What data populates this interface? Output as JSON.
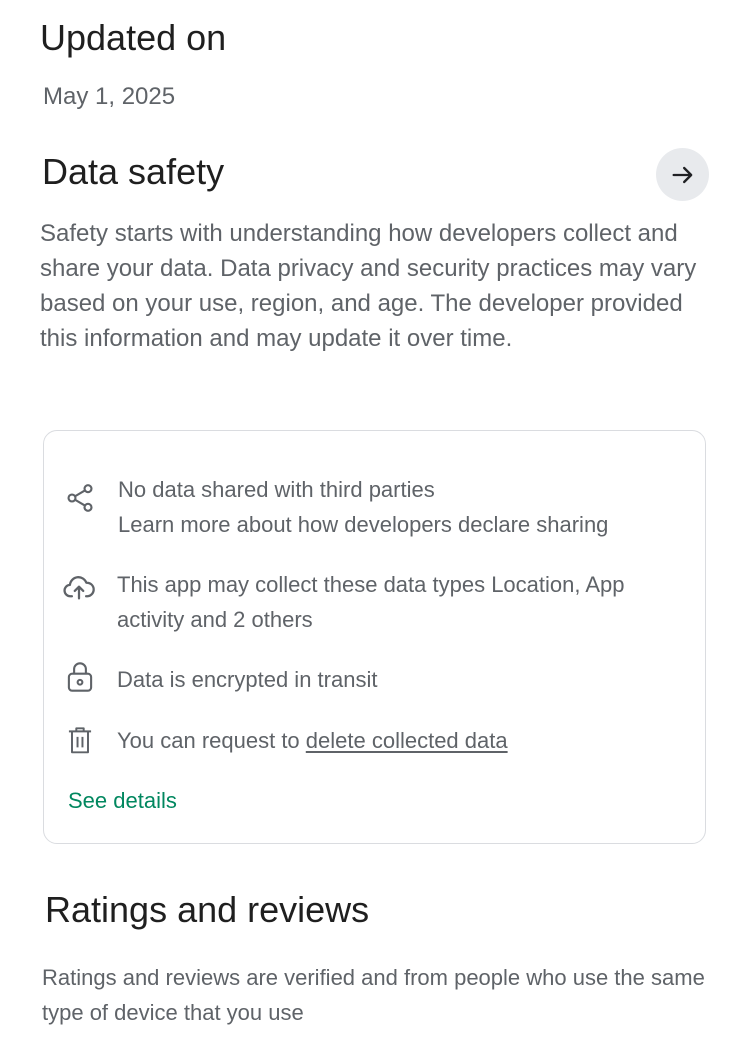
{
  "updated": {
    "heading": "Updated on",
    "date": "May 1, 2025"
  },
  "data_safety": {
    "heading": "Data safety",
    "description": "Safety starts with understanding how developers collect and share your data. Data privacy and security practices may vary based on your use, region, and age. The developer provided this information and may update it over time.",
    "items": [
      {
        "icon": "share-icon",
        "line1": "No data shared with third parties",
        "line2": "Learn more about how developers declare sharing"
      },
      {
        "icon": "cloud-upload-icon",
        "line1": "This app may collect these data types Location, App",
        "line2": "activity and 2 others"
      },
      {
        "icon": "lock-icon",
        "text": "Data is encrypted in transit"
      },
      {
        "icon": "trash-icon",
        "prefix": "You can request to ",
        "link": "delete collected data"
      }
    ],
    "see_details": "See details",
    "accent_color": "#01875f"
  },
  "ratings": {
    "heading": "Ratings and reviews",
    "description": "Ratings and reviews are verified and from people who use the same type of device that you use"
  }
}
